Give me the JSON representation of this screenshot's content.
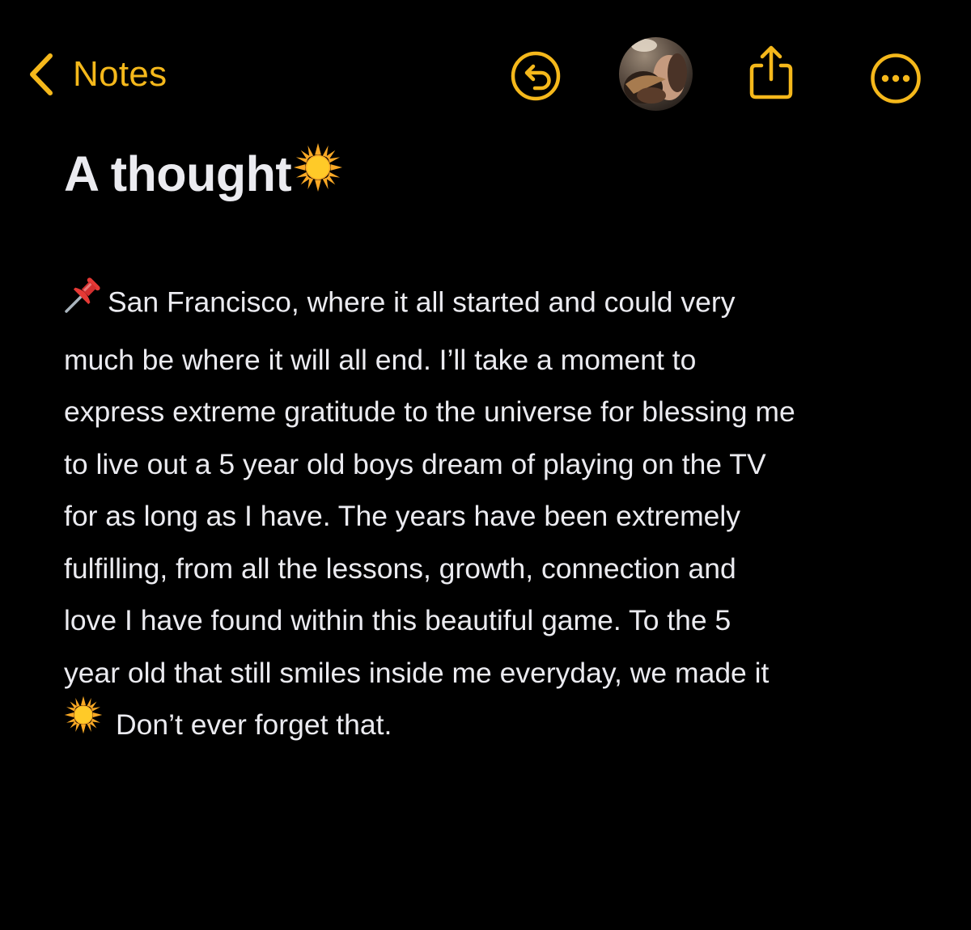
{
  "toolbar": {
    "back_label": "Notes",
    "back_icon": "chevron-left-icon",
    "undo_icon": "undo-icon",
    "avatar_icon": "collaborator-avatar",
    "share_icon": "share-icon",
    "more_icon": "ellipsis-circle-icon"
  },
  "colors": {
    "accent": "#f5b81b",
    "background": "#000000",
    "text": "#ebebf0"
  },
  "note": {
    "title": "A thought",
    "title_emoji": "sun-emoji",
    "body_start_emoji": "pushpin-emoji",
    "body_lines": [
      "San Francisco, where it all started and could very",
      "much be where it will all end. I’ll take a moment to",
      "express extreme gratitude to the universe for blessing me",
      "to live out a 5 year old boys dream of playing on the TV",
      "for as long as I have. The years have been extremely",
      "fulfilling, from all the lessons, growth, connection and",
      "love I have found within this beautiful game. To the 5",
      "year old that still smiles inside me everyday, we made it",
      "Don’t ever forget that."
    ]
  }
}
